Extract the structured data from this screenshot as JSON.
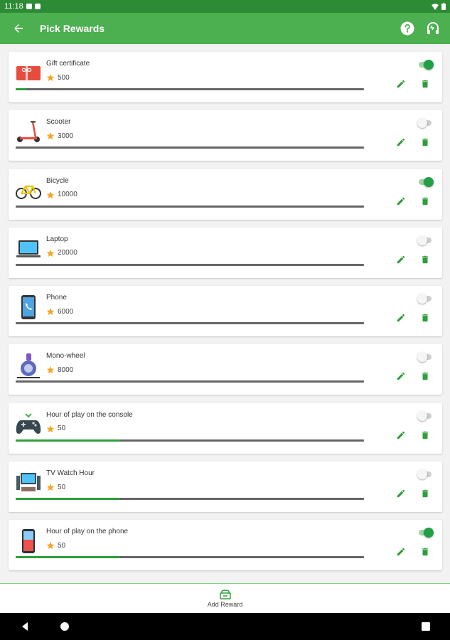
{
  "status": {
    "time": "11:18"
  },
  "appbar": {
    "title": "Pick Rewards"
  },
  "rewards": [
    {
      "name": "Gift certificate",
      "points": "500",
      "progress": 0.03,
      "enabled": true,
      "image": "gift-card-icon"
    },
    {
      "name": "Scooter",
      "points": "3000",
      "progress": 0.0,
      "enabled": false,
      "image": "scooter-icon"
    },
    {
      "name": "Bicycle",
      "points": "10000",
      "progress": 0.0,
      "enabled": true,
      "image": "bicycle-icon"
    },
    {
      "name": "Laptop",
      "points": "20000",
      "progress": 0.0,
      "enabled": false,
      "image": "laptop-icon"
    },
    {
      "name": "Phone",
      "points": "6000",
      "progress": 0.0,
      "enabled": false,
      "image": "phone-icon"
    },
    {
      "name": "Mono-wheel",
      "points": "8000",
      "progress": 0.0,
      "enabled": false,
      "image": "mono-wheel-icon"
    },
    {
      "name": "Hour of play on the console",
      "points": "50",
      "progress": 0.3,
      "enabled": false,
      "image": "gamepad-icon"
    },
    {
      "name": "TV Watch Hour",
      "points": "50",
      "progress": 0.3,
      "enabled": false,
      "image": "tv-icon"
    },
    {
      "name": "Hour of play on the phone",
      "points": "50",
      "progress": 0.3,
      "enabled": true,
      "image": "smartphone-icon"
    }
  ],
  "bottom_nav": {
    "add_label": "Add Reward"
  },
  "colors": {
    "appbar": "#4caf50",
    "accent": "#22a046",
    "statusbar": "#2e8b35"
  }
}
